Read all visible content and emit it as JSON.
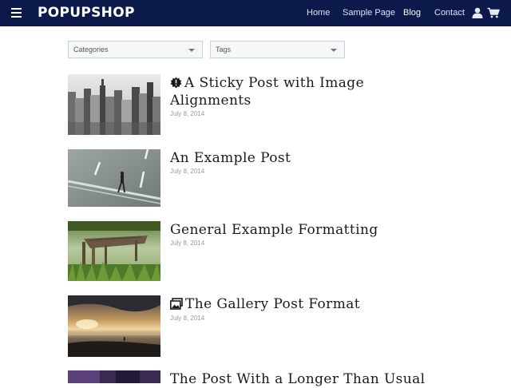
{
  "header": {
    "brand": "POPUPSHOP",
    "nav": [
      "Home",
      "Sample Page",
      "Blog",
      "Contact"
    ],
    "active_nav": "Blog",
    "colors": {
      "bar": "#0b1a4a",
      "text": "#ffffff"
    },
    "icons": [
      "menu-icon",
      "account-icon",
      "cart-icon"
    ]
  },
  "filters": {
    "categories_label": "Categories",
    "tags_label": "Tags"
  },
  "posts": [
    {
      "title": "A Sticky Post with Image Alignments",
      "date": "July 8, 2014",
      "title_icon": "sticky-badge-icon",
      "thumb": "city-skyline-photo"
    },
    {
      "title": "An Example Post",
      "date": "July 8, 2014",
      "thumb": "man-walking-on-road-photo"
    },
    {
      "title": "General Example Formatting",
      "date": "July 8, 2014",
      "thumb": "wooden-dock-in-water-photo"
    },
    {
      "title": "The Gallery Post Format",
      "date": "July 8, 2014",
      "title_icon": "gallery-icon",
      "thumb": "sunset-beach-photo"
    },
    {
      "title": "The Post With a Longer Than Usual",
      "thumb": "dark-purple-photo"
    }
  ]
}
